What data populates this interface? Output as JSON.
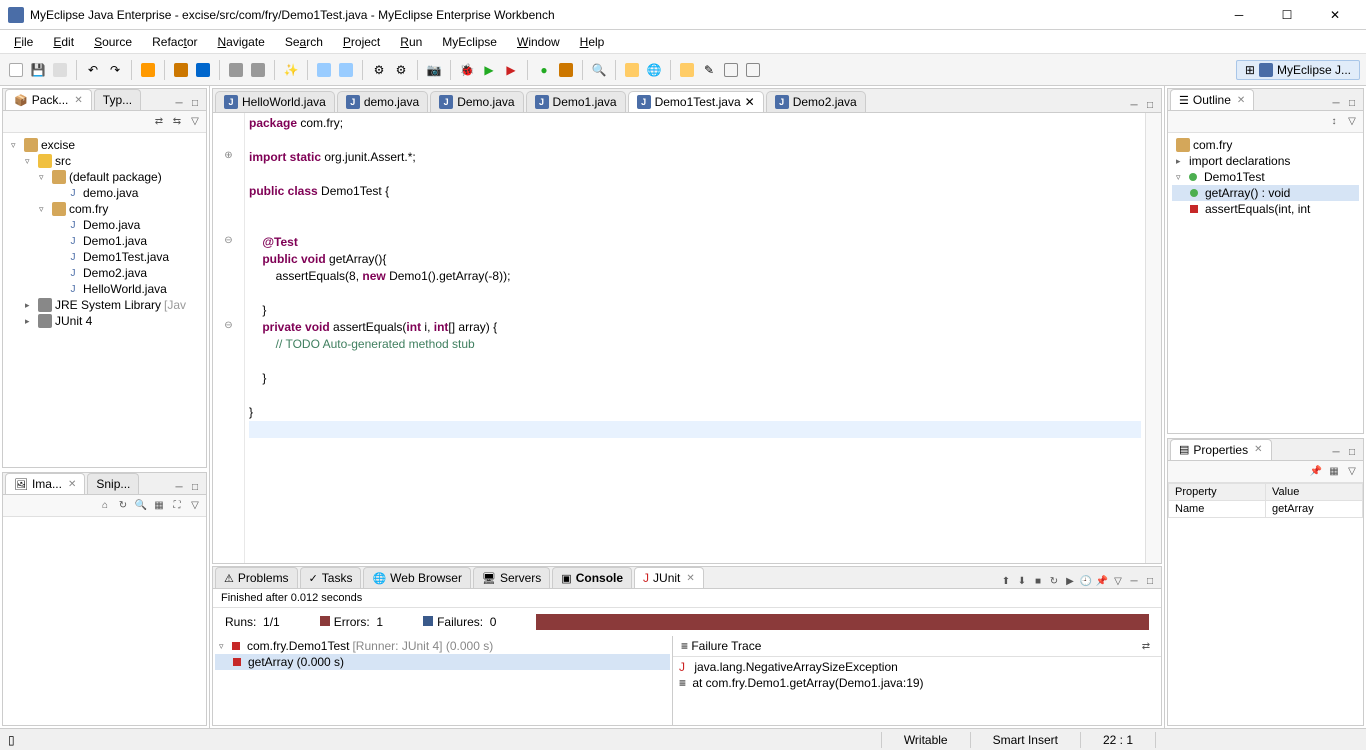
{
  "window": {
    "title": "MyEclipse Java Enterprise - excise/src/com/fry/Demo1Test.java - MyEclipse Enterprise Workbench"
  },
  "menu": [
    "File",
    "Edit",
    "Source",
    "Refactor",
    "Navigate",
    "Search",
    "Project",
    "Run",
    "MyEclipse",
    "Window",
    "Help"
  ],
  "perspective": "MyEclipse J...",
  "left": {
    "tabs": [
      "Pack...",
      "Typ..."
    ],
    "tree": {
      "project": "excise",
      "src": "src",
      "pkg_default": "(default package)",
      "file_demo_java": "demo.java",
      "pkg_comfry": "com.fry",
      "f_Demo": "Demo.java",
      "f_Demo1": "Demo1.java",
      "f_Demo1Test": "Demo1Test.java",
      "f_Demo2": "Demo2.java",
      "f_Hello": "HelloWorld.java",
      "jre": "JRE System Library",
      "jre_suffix": "[Jav",
      "junit": "JUnit 4"
    },
    "bottom_tabs": [
      "Ima...",
      "Snip..."
    ]
  },
  "editor": {
    "tabs": [
      "HelloWorld.java",
      "demo.java",
      "Demo.java",
      "Demo1.java",
      "Demo1Test.java",
      "Demo2.java"
    ],
    "active_tab": 4,
    "code_lines": [
      {
        "t": "package",
        "rest": " com.fry;"
      },
      {
        "raw": ""
      },
      {
        "t": "import static",
        "rest": " org.junit.Assert.*;"
      },
      {
        "raw": ""
      },
      {
        "t": "public class",
        "rest": " Demo1Test {"
      },
      {
        "raw": ""
      },
      {
        "raw": ""
      },
      {
        "indent": "    ",
        "t": "@Test"
      },
      {
        "indent": "    ",
        "t": "public void",
        "rest": " getArray(){"
      },
      {
        "indent": "        ",
        "plain": "assertEquals(8,",
        "kw": "new",
        "rest2": " Demo1().getArray(-8));"
      },
      {
        "raw": ""
      },
      {
        "indent": "    ",
        "plain": "}"
      },
      {
        "indent": "    ",
        "t": "private void",
        "rest": " assertEquals(",
        "kw2": "int",
        "mid": " i, ",
        "kw3": "int",
        "rest3": "[] array) {"
      },
      {
        "indent": "        ",
        "cm": "// TODO Auto-generated method stub"
      },
      {
        "raw": ""
      },
      {
        "indent": "    ",
        "plain": "}"
      },
      {
        "raw": ""
      },
      {
        "plain": "}"
      },
      {
        "cursor": "|"
      }
    ]
  },
  "bottom": {
    "tabs": [
      "Problems",
      "Tasks",
      "Web Browser",
      "Servers",
      "Console",
      "JUnit"
    ],
    "active_tab": 5,
    "status": "Finished after 0.012 seconds",
    "runs_label": "Runs:",
    "runs_value": "1/1",
    "errors_label": "Errors:",
    "errors_value": "1",
    "failures_label": "Failures:",
    "failures_value": "0",
    "test_class": "com.fry.Demo1Test",
    "test_runner": " [Runner: JUnit 4] (0.000 s)",
    "test_method": "getArray (0.000 s)",
    "trace_title": "Failure Trace",
    "trace_1": "java.lang.NegativeArraySizeException",
    "trace_2": "at com.fry.Demo1.getArray(Demo1.java:19)"
  },
  "outline": {
    "title": "Outline",
    "pkg": "com.fry",
    "imports": "import declarations",
    "class": "Demo1Test",
    "m1": "getArray() : void",
    "m2": "assertEquals(int, int"
  },
  "properties": {
    "title": "Properties",
    "col1": "Property",
    "col2": "Value",
    "row1_k": "Name",
    "row1_v": "getArray"
  },
  "status": {
    "writable": "Writable",
    "insert": "Smart Insert",
    "pos": "22 : 1"
  }
}
